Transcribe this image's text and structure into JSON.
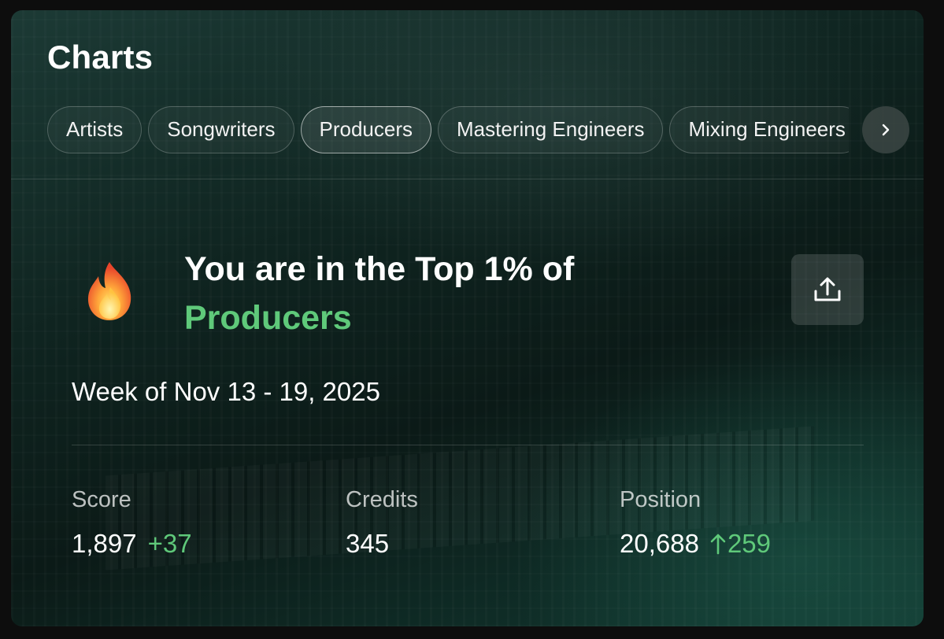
{
  "header": {
    "title": "Charts"
  },
  "tabs": [
    {
      "label": "Artists",
      "active": false
    },
    {
      "label": "Songwriters",
      "active": false
    },
    {
      "label": "Producers",
      "active": true
    },
    {
      "label": "Mastering Engineers",
      "active": false
    },
    {
      "label": "Mixing Engineers",
      "active": false
    }
  ],
  "tabs_next_icon": "chevron-right-icon",
  "highlight": {
    "icon": "fire-icon",
    "headline": "You are in the Top 1% of",
    "category": "Producers",
    "share_icon": "share-upload-icon"
  },
  "week": "Week of Nov 13 - 19, 2025",
  "stats": {
    "score": {
      "label": "Score",
      "value": "1,897",
      "delta": "+37"
    },
    "credits": {
      "label": "Credits",
      "value": "345"
    },
    "position": {
      "label": "Position",
      "value": "20,688",
      "delta": "259",
      "delta_icon": "arrow-up-icon"
    }
  },
  "colors": {
    "accent_green": "#5fc97a",
    "card_bg": "#0f2420"
  }
}
